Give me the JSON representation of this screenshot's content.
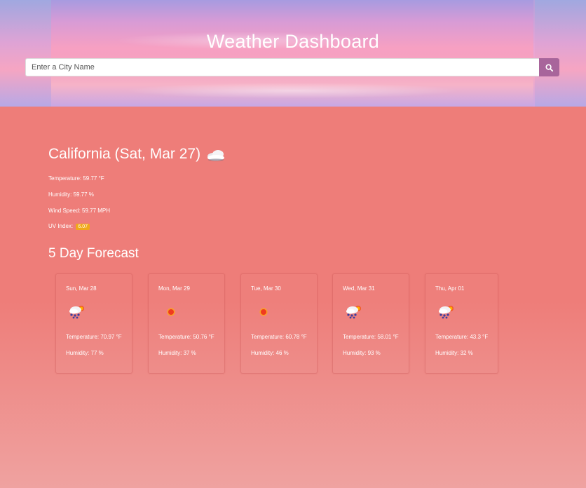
{
  "header": {
    "title": "Weather Dashboard",
    "search_placeholder": "Enter a City Name",
    "search_icon": "search-icon"
  },
  "current": {
    "city_date": "California (Sat, Mar 27)",
    "icon": "cloudy-icon",
    "temperature": "Temperature: 59.77 °F",
    "humidity": "Humidity: 59.77 %",
    "wind": "Wind Speed: 59.77 MPH",
    "uv_label": "UV Index:",
    "uv_value": "6.07",
    "uv_color": "#f0a81a"
  },
  "forecast": {
    "title": "5 Day Forecast",
    "days": [
      {
        "date": "Sun, Mar 28",
        "icon": "rain-sun-icon",
        "temp": "Temperature: 70.97 °F",
        "humidity": "Humidity: 77 %"
      },
      {
        "date": "Mon, Mar 29",
        "icon": "sun-icon",
        "temp": "Temperature: 50.76 °F",
        "humidity": "Humidity: 37 %"
      },
      {
        "date": "Tue, Mar 30",
        "icon": "sun-icon",
        "temp": "Temperature: 60.78 °F",
        "humidity": "Humidity: 46 %"
      },
      {
        "date": "Wed, Mar 31",
        "icon": "rain-sun-icon",
        "temp": "Temperature: 58.01 °F",
        "humidity": "Humidity: 93 %"
      },
      {
        "date": "Thu, Apr 01",
        "icon": "rain-sun-icon",
        "temp": "Temperature: 43.3 °F",
        "humidity": "Humidity: 32 %"
      }
    ]
  },
  "colors": {
    "background": "#ee7d79",
    "search_button": "#a8659b"
  }
}
